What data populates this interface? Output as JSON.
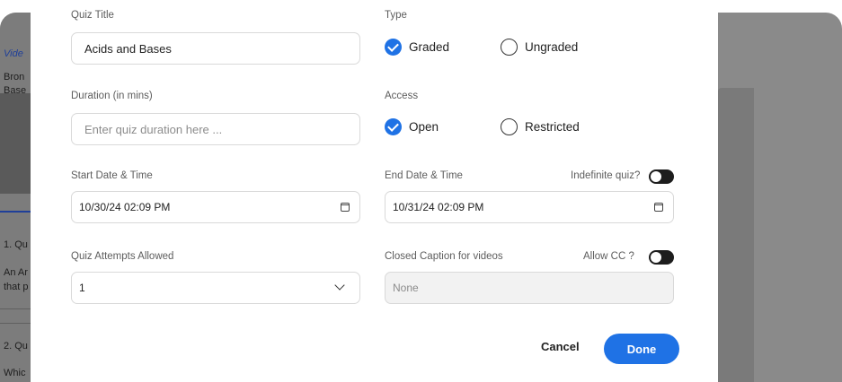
{
  "background": {
    "left_fragments": [
      "Vide",
      "Bron",
      "Base",
      "1. Qu",
      "An Ar",
      "that p",
      "2. Qu",
      "Whic"
    ]
  },
  "form": {
    "quiz_title": {
      "label": "Quiz Title",
      "value": "Acids and Bases"
    },
    "type": {
      "label": "Type",
      "options": [
        {
          "label": "Graded",
          "checked": true
        },
        {
          "label": "Ungraded",
          "checked": false
        }
      ]
    },
    "duration": {
      "label": "Duration (in mins)",
      "placeholder": "Enter quiz duration here ..."
    },
    "access": {
      "label": "Access",
      "options": [
        {
          "label": "Open",
          "checked": true
        },
        {
          "label": "Restricted",
          "checked": false
        }
      ]
    },
    "start": {
      "label": "Start Date & Time",
      "value": "10/30/24 02:09 PM",
      "icon": "calendar-icon"
    },
    "end": {
      "label": "End Date & Time",
      "value": "10/31/24 02:09 PM",
      "icon": "calendar-icon"
    },
    "indefinite": {
      "label": "Indefinite quiz?"
    },
    "attempts": {
      "label": "Quiz Attempts Allowed",
      "value": "1",
      "icon": "chevron-down-icon"
    },
    "closed_caption": {
      "label": "Closed Caption for videos",
      "value": "None"
    },
    "allow_cc": {
      "label": "Allow CC ?"
    }
  },
  "actions": {
    "cancel": "Cancel",
    "done": "Done"
  },
  "colors": {
    "accent": "#1f72e5",
    "overlay": "#8a8a8a"
  }
}
